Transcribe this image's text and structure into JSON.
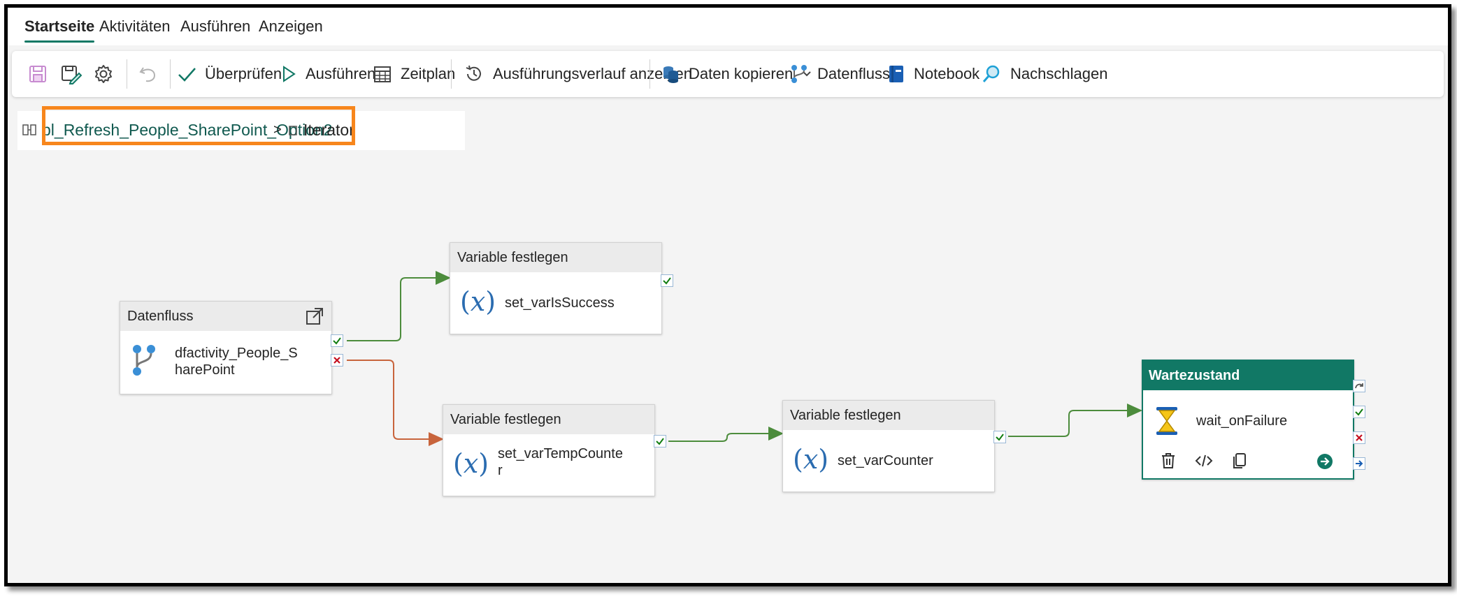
{
  "tabs": [
    {
      "label": "Startseite",
      "active": true
    },
    {
      "label": "Aktivitäten"
    },
    {
      "label": "Ausführen"
    },
    {
      "label": "Anzeigen"
    }
  ],
  "toolbar": {
    "save_icon": "save-icon",
    "save_as_icon": "save-as-icon",
    "settings_icon": "gear-icon",
    "undo_icon": "undo-icon",
    "validate_label": "Überprüfen",
    "run_label": "Ausführen",
    "schedule_label": "Zeitplan",
    "history_label": "Ausführungsverlauf anzeigen",
    "copy_data_label": "Daten kopieren",
    "dataflow_label": "Datenfluss",
    "notebook_label": "Notebook",
    "lookup_label": "Nachschlagen"
  },
  "breadcrumb": {
    "pipeline": "pl_Refresh_People_SharePoint_Option2",
    "separator": ">",
    "current": "Iterator"
  },
  "nodes": {
    "dataflow": {
      "type_label": "Datenfluss",
      "name_line1": "dfactivity_People_S",
      "name_line2": "harePoint"
    },
    "var_success": {
      "type_label": "Variable festlegen",
      "name": "set_varIsSuccess"
    },
    "var_temp": {
      "type_label": "Variable festlegen",
      "name_line1": "set_varTempCounte",
      "name_line2": "r"
    },
    "var_counter": {
      "type_label": "Variable festlegen",
      "name": "set_varCounter"
    },
    "wait": {
      "type_label": "Wartezustand",
      "name": "wait_onFailure"
    }
  },
  "colors": {
    "accent": "#117865",
    "success": "#4c8c3c",
    "failure": "#c8643c",
    "highlight": "#f7861c",
    "wait_header": "#117865"
  }
}
